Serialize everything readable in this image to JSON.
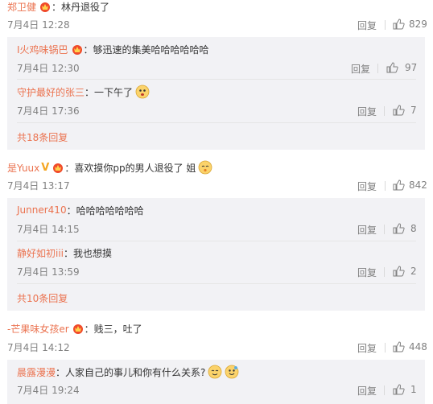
{
  "comments": [
    {
      "user": "郑卫健",
      "text": "：林丹退役了",
      "date": "7月4日 12:28",
      "reply_label": "回复",
      "likes": "829",
      "replies": [
        {
          "user": "I火鸡味锅巴",
          "text": "：够迅速的集美哈哈哈哈哈哈",
          "date": "7月4日 12:30",
          "reply_label": "回复",
          "likes": "97"
        },
        {
          "user": "守护最好的张三",
          "text": "：一下午了",
          "date": "7月4日 17:36",
          "reply_label": "回复",
          "likes": "7"
        }
      ],
      "more": "共18条回复"
    },
    {
      "user": "是Yuux",
      "text": "：喜欢摸你pp的男人退役了 姐",
      "date": "7月4日 13:17",
      "reply_label": "回复",
      "likes": "842",
      "replies": [
        {
          "user": "Junner410",
          "text": "：哈哈哈哈哈哈哈",
          "date": "7月4日 14:15",
          "reply_label": "回复",
          "likes": "8"
        },
        {
          "user": "静好如初iii",
          "text": "：我也想摸",
          "date": "7月4日 13:59",
          "reply_label": "回复",
          "likes": "2"
        }
      ],
      "more": "共10条回复"
    },
    {
      "user": "-芒果味女孩er",
      "text": "：贱三，吐了",
      "date": "7月4日 14:12",
      "reply_label": "回复",
      "likes": "448",
      "replies": [
        {
          "user": "晨露漫漫",
          "text": "：人家自己的事儿和你有什么关系?",
          "date": "7月4日 19:24",
          "reply_label": "回复",
          "likes": "1"
        }
      ]
    }
  ],
  "icons": {
    "badge": "member-crown-icon",
    "like": "thumbs-up-icon",
    "verified": "v-verified-icon",
    "emoji": "emoji-face-icon"
  },
  "colors": {
    "username": "#eb7350",
    "text": "#333333",
    "meta": "#808080",
    "panel": "#f2f2f5"
  }
}
